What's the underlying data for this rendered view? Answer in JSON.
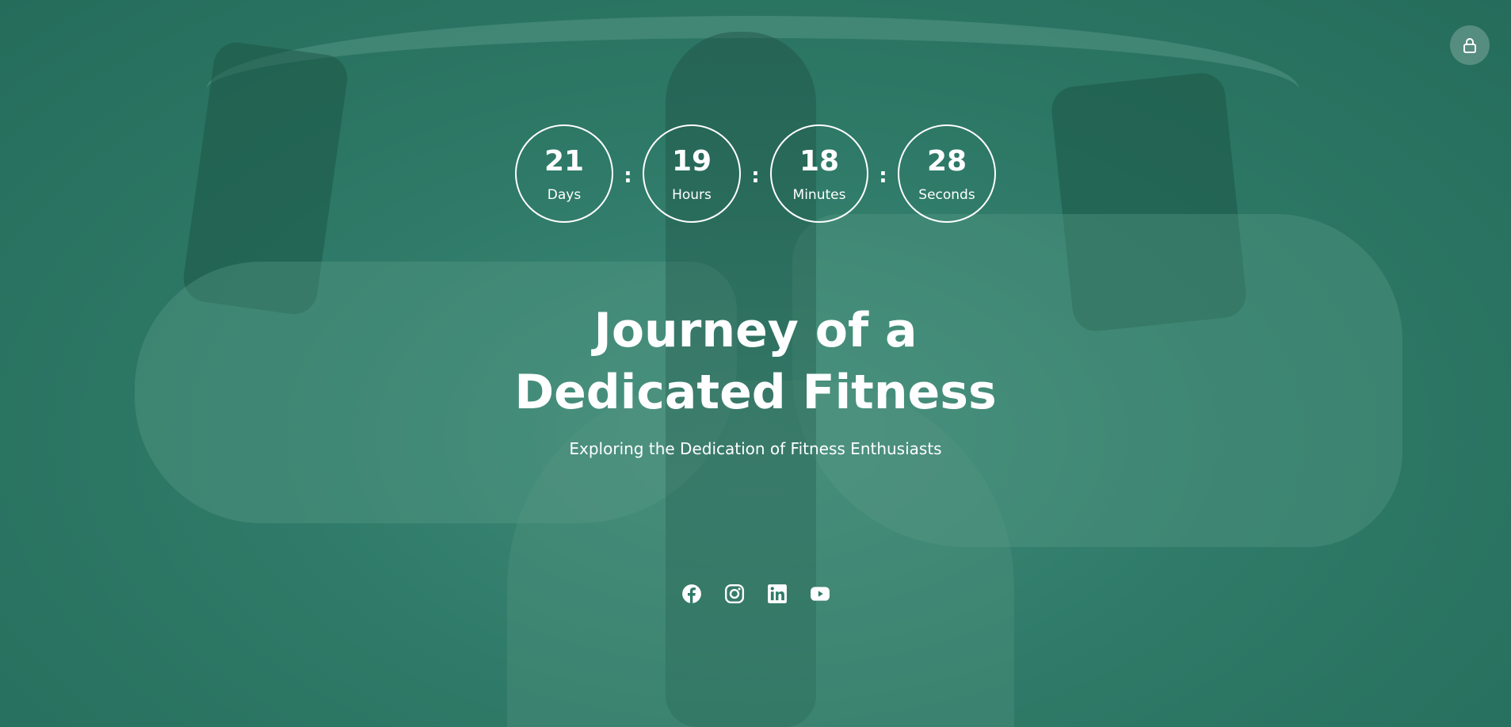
{
  "countdown": {
    "days": {
      "value": "21",
      "label": "Days"
    },
    "hours": {
      "value": "19",
      "label": "Hours"
    },
    "minutes": {
      "value": "18",
      "label": "Minutes"
    },
    "seconds": {
      "value": "28",
      "label": "Seconds"
    },
    "separator": ":"
  },
  "hero": {
    "title_line1": "Journey of a",
    "title_line2": "Dedicated Fitness",
    "subtitle": "Exploring the Dedication of Fitness Enthusiasts"
  },
  "header": {
    "lock_icon": "lock-icon"
  },
  "social": {
    "icons": [
      "facebook-icon",
      "instagram-icon",
      "linkedin-icon",
      "youtube-icon"
    ]
  },
  "colors": {
    "overlay": "#2f7a68",
    "text": "#ffffff"
  }
}
